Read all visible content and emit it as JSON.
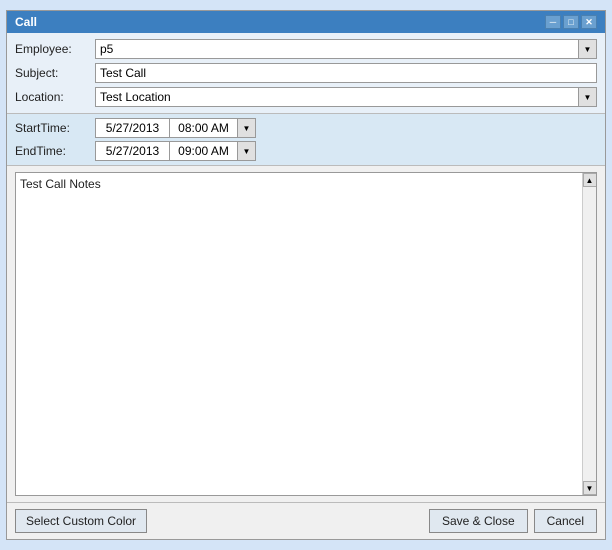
{
  "window": {
    "title": "Call",
    "title_extra": ""
  },
  "titlebar": {
    "minimize_label": "─",
    "maximize_label": "□",
    "close_label": "✕"
  },
  "form": {
    "employee_label": "Employee:",
    "employee_value": "p5",
    "subject_label": "Subject:",
    "subject_value": "Test Call",
    "location_label": "Location:",
    "location_value": "Test Location",
    "dropdown_arrow": "▼"
  },
  "datetime": {
    "starttime_label": "StartTime:",
    "starttime_date": "5/27/2013",
    "starttime_time": "08:00 AM",
    "endtime_label": "EndTime:",
    "endtime_date": "5/27/2013",
    "endtime_time": "09:00 AM",
    "dropdown_arrow": "▼"
  },
  "notes": {
    "value": "Test Call Notes"
  },
  "footer": {
    "select_custom_color_label": "Select Custom Color",
    "save_close_label": "Save & Close",
    "cancel_label": "Cancel",
    "scrollbar_up": "▲",
    "scrollbar_down": "▼"
  }
}
